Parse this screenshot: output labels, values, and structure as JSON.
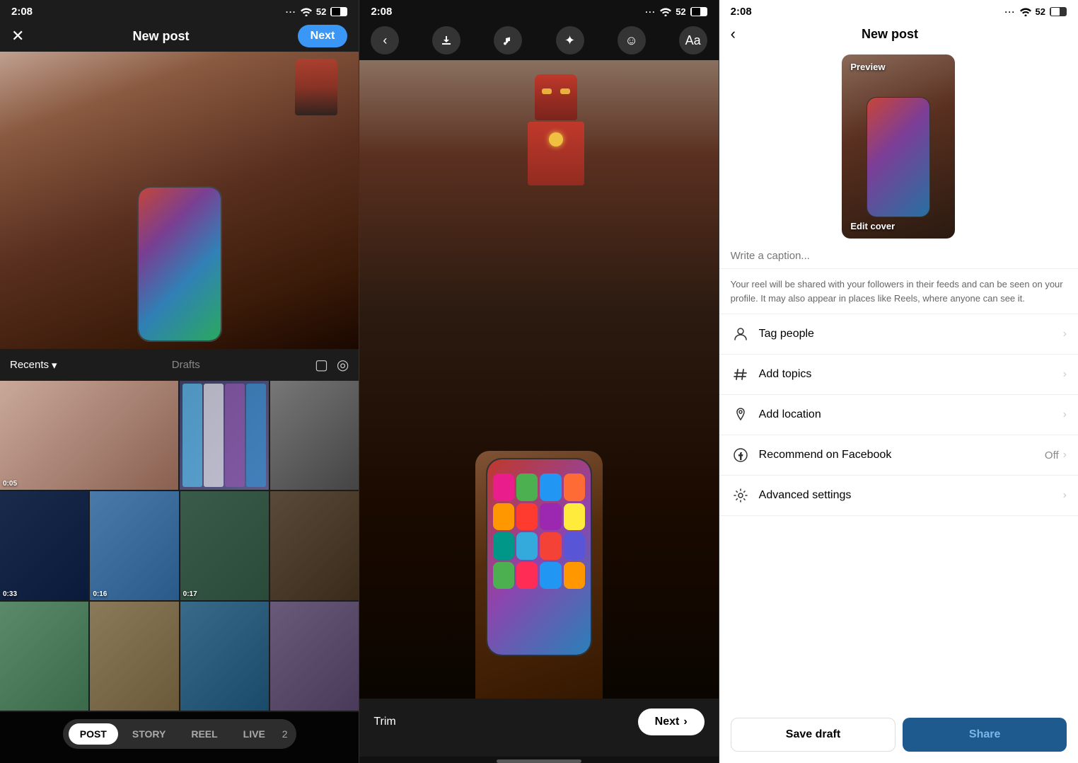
{
  "panel1": {
    "status_time": "2:08",
    "dots": "···",
    "battery": "52",
    "title": "New post",
    "close_label": "✕",
    "next_label": "Next",
    "recents_label": "Recents",
    "drafts_label": "Drafts",
    "tabs": [
      {
        "label": "POST",
        "active": true
      },
      {
        "label": "STORY",
        "active": false
      },
      {
        "label": "REEL",
        "active": false
      },
      {
        "label": "LIVE",
        "active": false
      }
    ],
    "tab_number": "2",
    "thumbnails": [
      {
        "id": 1,
        "duration": "0:05",
        "color": "t-wide t1"
      },
      {
        "id": 2,
        "duration": "",
        "color": "t2"
      },
      {
        "id": 3,
        "duration": "",
        "color": "t3"
      },
      {
        "id": 4,
        "duration": "0:33",
        "color": "t5"
      },
      {
        "id": 5,
        "duration": "0:16",
        "color": "t6"
      },
      {
        "id": 6,
        "duration": "0:17",
        "color": "t7"
      },
      {
        "id": 7,
        "duration": "",
        "color": "t8"
      },
      {
        "id": 8,
        "duration": "",
        "color": "t9"
      },
      {
        "id": 9,
        "duration": "",
        "color": "t10"
      },
      {
        "id": 10,
        "duration": "",
        "color": "t11"
      },
      {
        "id": 11,
        "duration": "",
        "color": "t12"
      },
      {
        "id": 12,
        "duration": "",
        "color": "t4"
      }
    ]
  },
  "panel2": {
    "status_time": "2:08",
    "battery": "52",
    "trim_label": "Trim",
    "next_label": "Next",
    "next_chevron": "›",
    "toolbar_icons": [
      "download",
      "music",
      "sparkle",
      "emoji",
      "text"
    ]
  },
  "panel3": {
    "status_time": "2:08",
    "battery": "52",
    "title": "New post",
    "back_label": "‹",
    "cover_preview_label": "Preview",
    "cover_edit_label": "Edit cover",
    "caption_placeholder": "Write a caption...",
    "info_text": "Your reel will be shared with your followers in their feeds and can be seen on your profile. It may also appear in places like Reels, where anyone can see it.",
    "settings_rows": [
      {
        "icon": "👤",
        "label": "Tag people",
        "value": "",
        "has_chevron": true
      },
      {
        "icon": "#",
        "label": "Add topics",
        "value": "",
        "has_chevron": true
      },
      {
        "icon": "📍",
        "label": "Add location",
        "value": "",
        "has_chevron": true
      },
      {
        "icon": "Ⓕ",
        "label": "Recommend on Facebook",
        "value": "Off",
        "has_chevron": true
      },
      {
        "icon": "⚙",
        "label": "Advanced settings",
        "value": "",
        "has_chevron": true
      }
    ],
    "save_draft_label": "Save draft",
    "share_label": "Share"
  }
}
